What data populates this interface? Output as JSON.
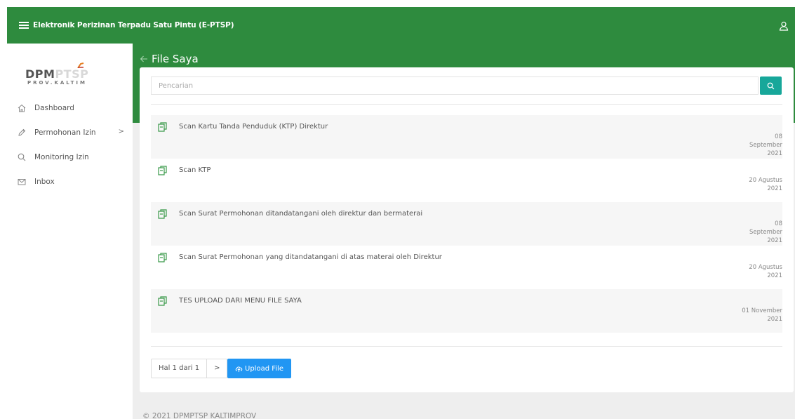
{
  "header": {
    "title": "Elektronik Perizinan Terpadu Satu Pintu (E-PTSP)",
    "menu_icon": "hamburger-icon",
    "user_icon": "user-icon",
    "color": "#2e8b3e"
  },
  "logo": {
    "brand_a": "DPM",
    "brand_b": "PTSP",
    "sub": "PROV.KALTIM"
  },
  "sidebar": {
    "items": [
      {
        "label": "Dashboard",
        "icon": "home-icon"
      },
      {
        "label": "Permohonan Izin",
        "icon": "pencil-icon",
        "arrow": ">"
      },
      {
        "label": "Monitoring Izin",
        "icon": "search-icon"
      },
      {
        "label": "Inbox",
        "icon": "mail-icon"
      }
    ]
  },
  "page": {
    "title": "File Saya",
    "back_icon": "arrow-left-icon"
  },
  "search": {
    "placeholder": "Pencarian",
    "value": "",
    "button_color": "#17a79a"
  },
  "files": [
    {
      "name": "Scan Kartu Tanda Penduduk (KTP) Direktur",
      "date_line1": "08 September",
      "date_line2": "2021"
    },
    {
      "name": "Scan KTP",
      "date_line1": "20 Agustus",
      "date_line2": "2021"
    },
    {
      "name": "Scan Surat Permohonan ditandatangani oleh direktur dan bermaterai",
      "date_line1": "08 September",
      "date_line2": "2021"
    },
    {
      "name": "Scan Surat Permohonan yang ditandatangani di atas materai oleh Direktur",
      "date_line1": "20 Agustus",
      "date_line2": "2021"
    },
    {
      "name": "TES UPLOAD DARI MENU FILE SAYA",
      "date_line1": "01 November",
      "date_line2": "2021"
    }
  ],
  "pagination": {
    "label": "Hal 1 dari 1",
    "next": ">"
  },
  "upload": {
    "label": "Upload File",
    "color": "#2196f3"
  },
  "footer": {
    "text": "© 2021 DPMPTSP KALTIMPROV"
  }
}
